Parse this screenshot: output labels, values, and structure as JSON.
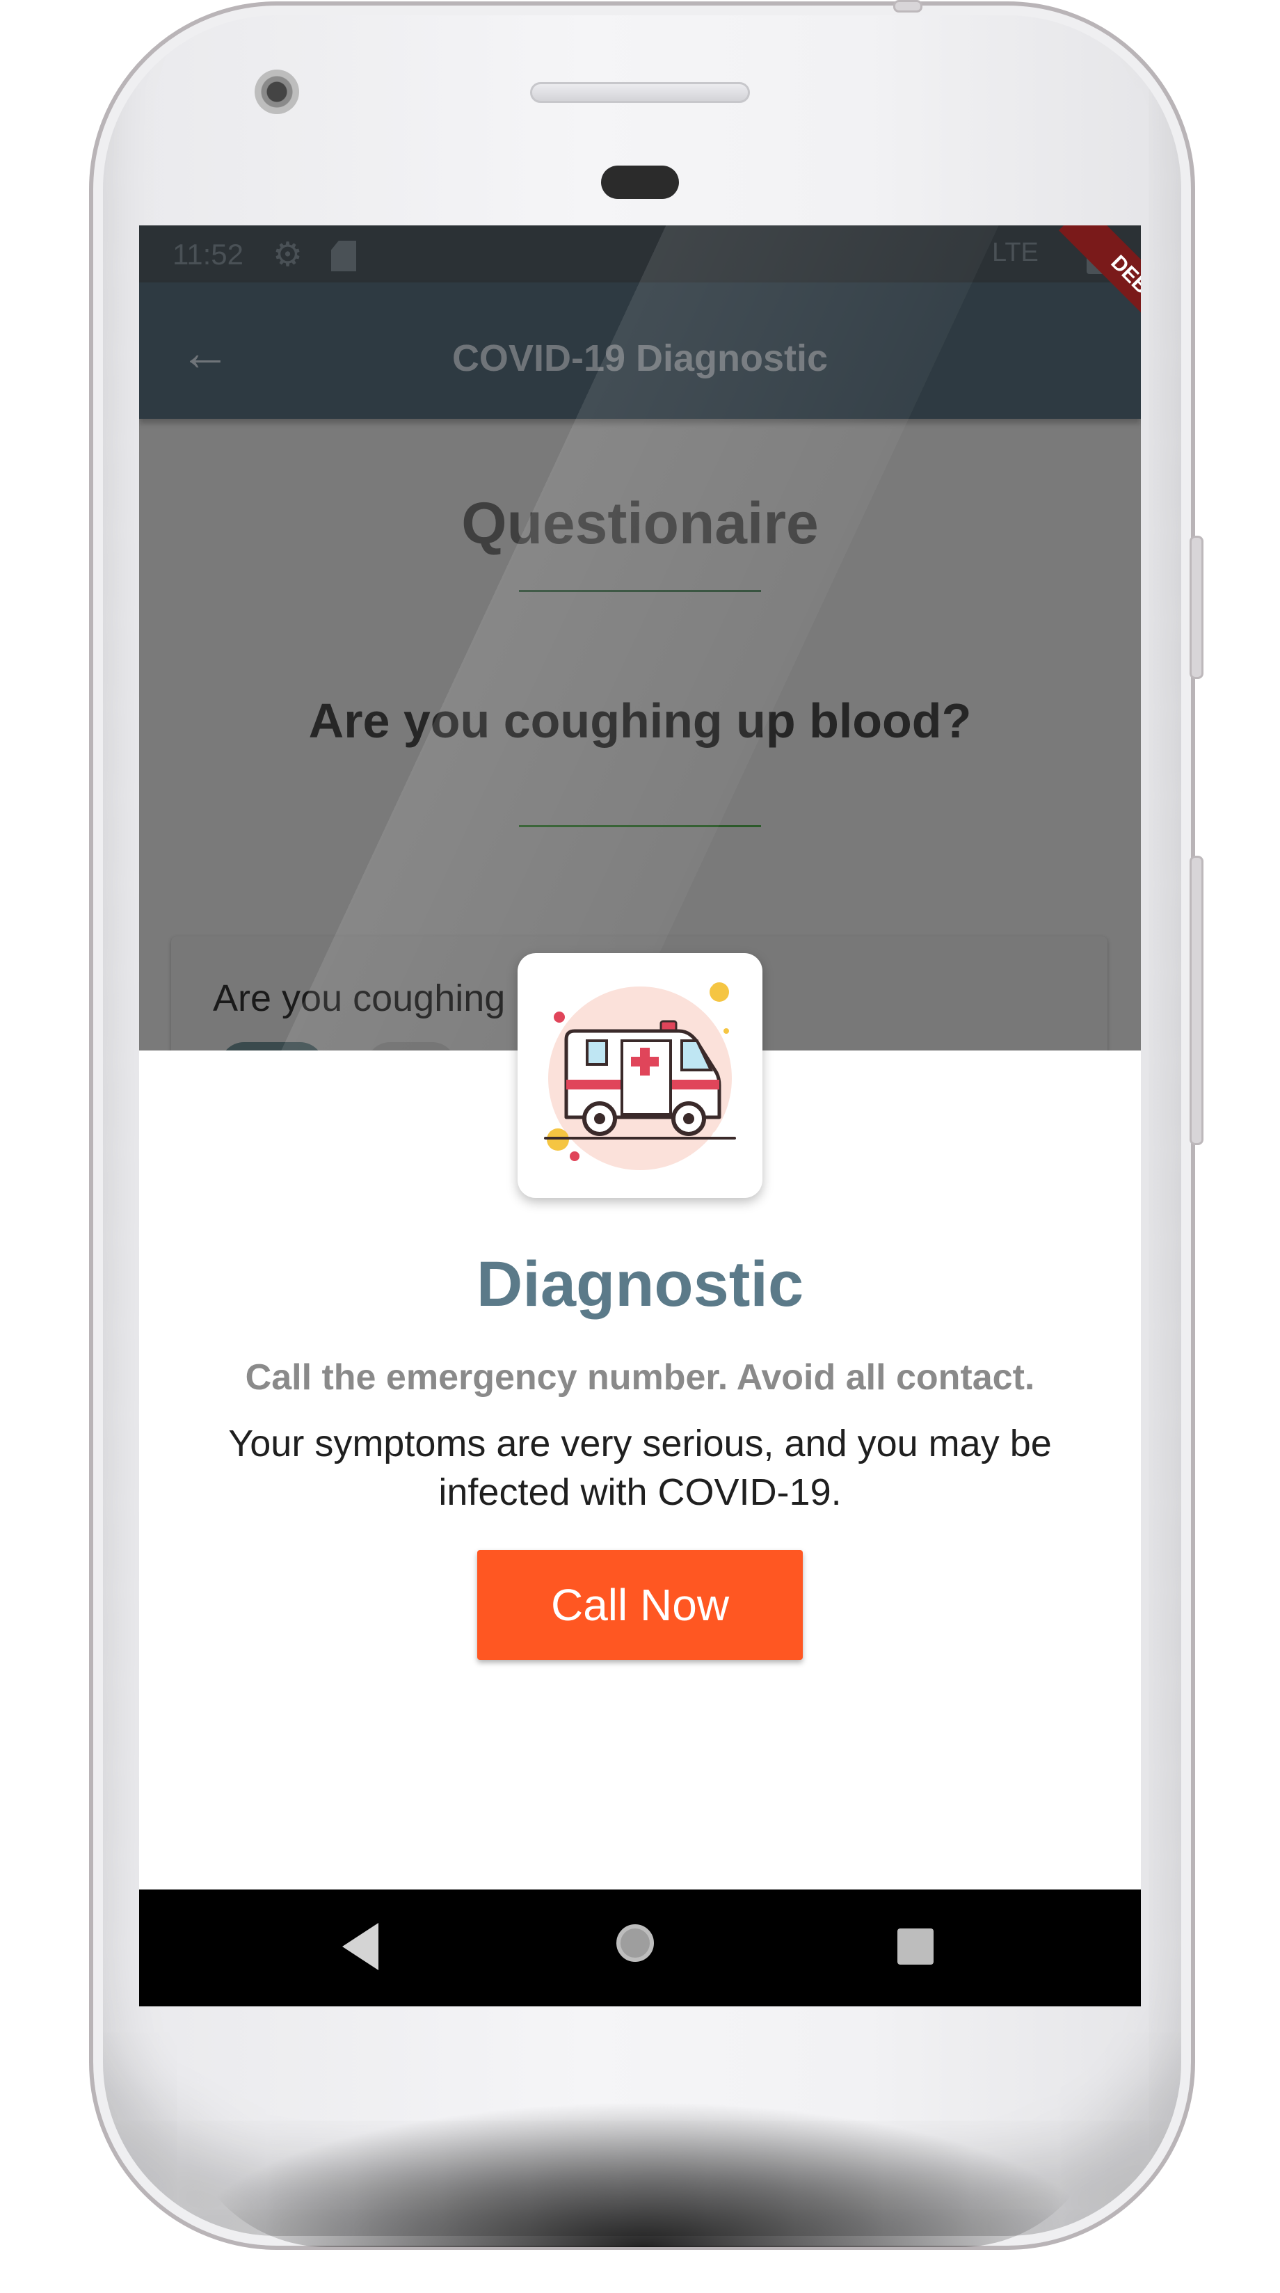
{
  "status_bar": {
    "time": "11:52",
    "network": "LTE",
    "icons": [
      "gear-icon",
      "sd-card-icon",
      "battery-icon"
    ]
  },
  "app_bar": {
    "title": "COVID-19 Diagnostic",
    "back_icon": "arrow-left-icon"
  },
  "page": {
    "heading": "Questionaire",
    "question": "Are you coughing up blood?",
    "card_text": "Are you coughing"
  },
  "dialog": {
    "icon": "ambulance-icon",
    "title": "Diagnostic",
    "subtitle": "Call the emergency number. Avoid all contact.",
    "message": "Your symptoms are very serious, and you may be infected with COVID-19.",
    "button_label": "Call Now"
  },
  "debug_banner": "DEBUG",
  "colors": {
    "accent": "#ff5722",
    "title": "#5b7a89",
    "appbar": "#2e3a42"
  }
}
